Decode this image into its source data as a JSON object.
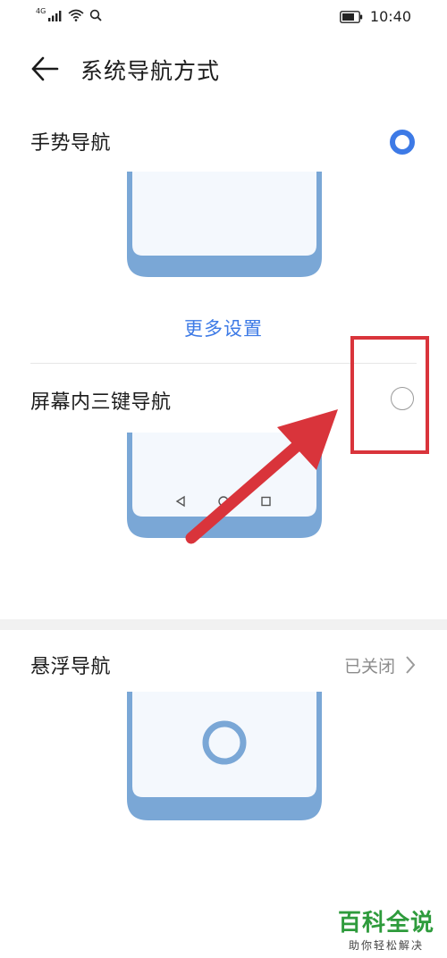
{
  "status_bar": {
    "network": "4G",
    "time": "10:40"
  },
  "header": {
    "title": "系统导航方式"
  },
  "options": [
    {
      "label": "手势导航",
      "selected": true
    },
    {
      "label": "屏幕内三键导航",
      "selected": false
    }
  ],
  "more_settings": "更多设置",
  "floating_nav": {
    "label": "悬浮导航",
    "status": "已关闭"
  },
  "colors": {
    "accent": "#3d7ae6",
    "phone_frame": "#7aa7d6",
    "annotation": "#d9343b",
    "watermark": "#2e9b3c"
  },
  "watermark": {
    "main": "百科全说",
    "sub": "助你轻松解决"
  }
}
